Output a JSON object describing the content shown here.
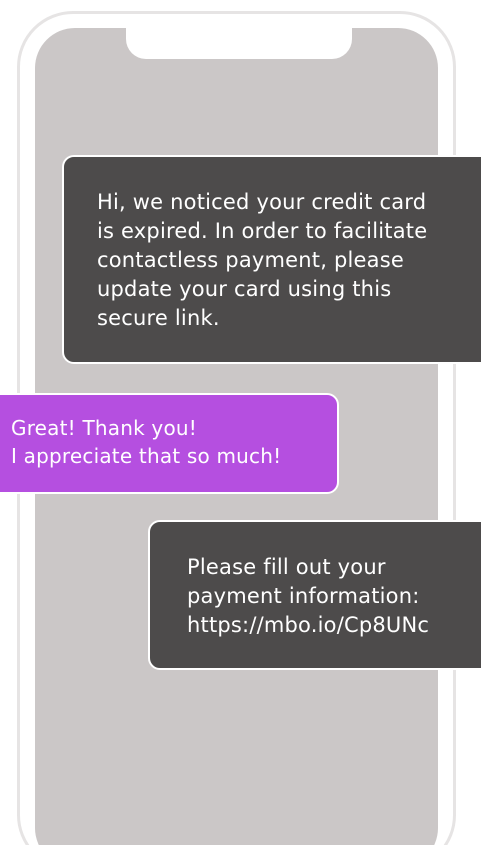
{
  "conversation": {
    "messages": [
      {
        "sender": "business",
        "text": "Hi, we noticed your credit card\nis expired. In order to facilitate\ncontactless payment, please\nupdate your card using this\nsecure link."
      },
      {
        "sender": "customer",
        "text": "Great! Thank you!\nI appreciate that so much!"
      },
      {
        "sender": "business",
        "text": "Please fill out your\npayment information:\nhttps://mbo.io/Cp8UNc"
      }
    ]
  },
  "colors": {
    "screen": "#cbc7c7",
    "incoming_bubble": "#4d4b4b",
    "outgoing_bubble": "#b54fe0",
    "frame": "#e6e4e4"
  }
}
